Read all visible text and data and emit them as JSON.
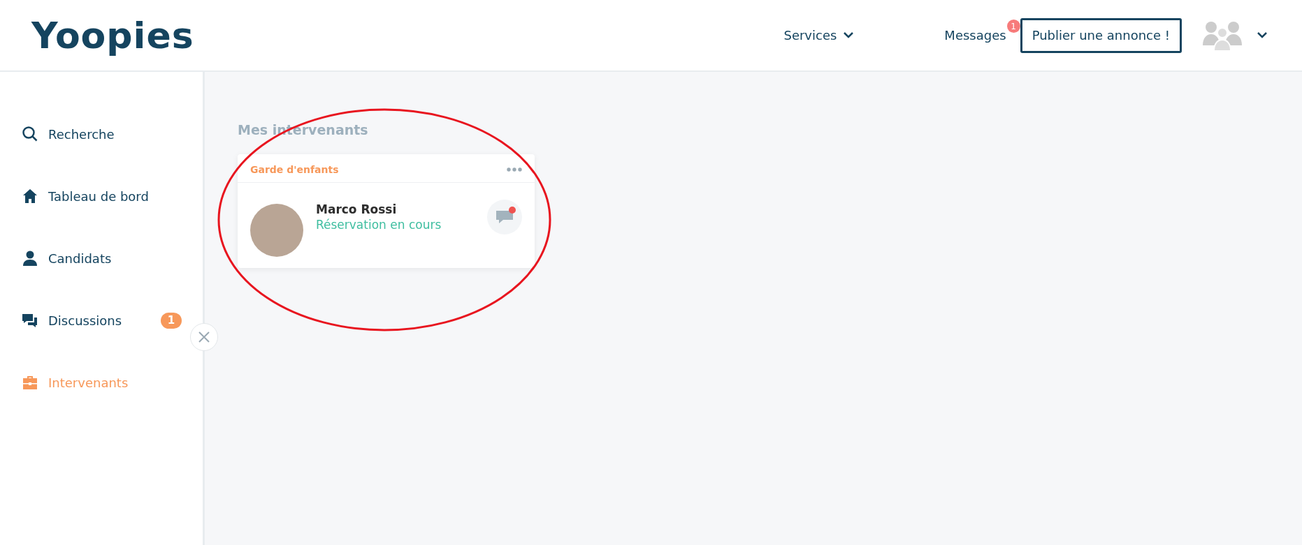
{
  "header": {
    "logo": "Yoopies",
    "nav": [
      {
        "label": "Services",
        "kind": "dropdown"
      },
      {
        "label": "Messages",
        "kind": "badge",
        "badge": "1"
      }
    ],
    "publish_button": "Publier une annonce !"
  },
  "sidebar": {
    "items": [
      {
        "label": "Recherche",
        "kind": "search",
        "selected": false
      },
      {
        "label": "Tableau de bord",
        "kind": "home",
        "selected": false
      },
      {
        "label": "Candidats",
        "kind": "person",
        "selected": false
      },
      {
        "label": "Discussions",
        "kind": "chat",
        "selected": false,
        "badge": "1"
      },
      {
        "label": "Intervenants",
        "kind": "briefcase",
        "selected": true
      }
    ]
  },
  "main": {
    "title": "Mes intervenants",
    "cards": [
      {
        "category": "Garde d'enfants",
        "name": "Marco Rossi",
        "status": "Réservation en cours",
        "unread": true
      }
    ]
  }
}
